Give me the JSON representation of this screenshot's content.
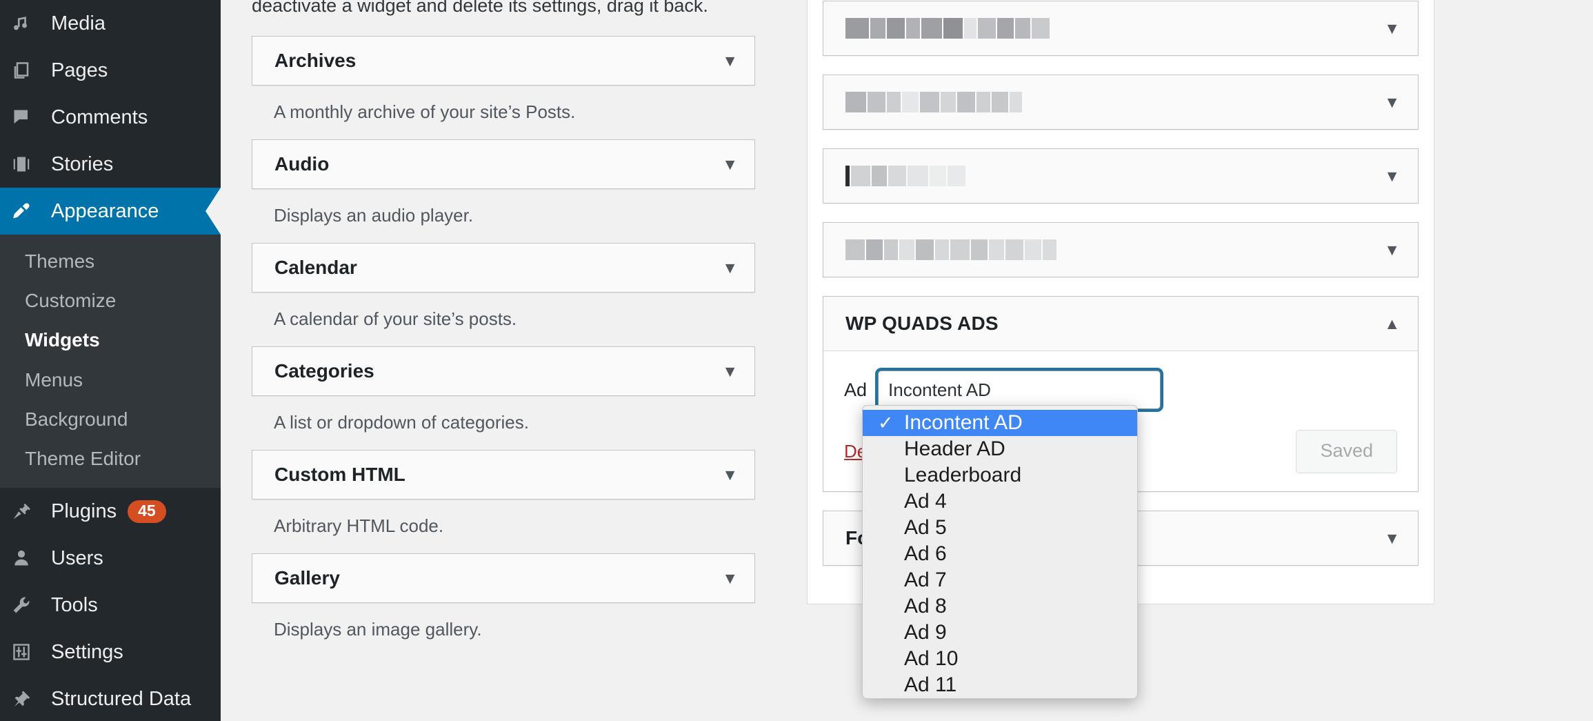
{
  "sidebar": {
    "items": [
      {
        "label": "Media",
        "icon": "media-icon",
        "current": false,
        "badge": null
      },
      {
        "label": "Pages",
        "icon": "pages-icon",
        "current": false,
        "badge": null
      },
      {
        "label": "Comments",
        "icon": "comments-icon",
        "current": false,
        "badge": null
      },
      {
        "label": "Stories",
        "icon": "stories-icon",
        "current": false,
        "badge": null
      },
      {
        "label": "Appearance",
        "icon": "appearance-icon",
        "current": true,
        "badge": null
      },
      {
        "label": "Plugins",
        "icon": "plugins-icon",
        "current": false,
        "badge": "45"
      },
      {
        "label": "Users",
        "icon": "users-icon",
        "current": false,
        "badge": null
      },
      {
        "label": "Tools",
        "icon": "tools-icon",
        "current": false,
        "badge": null
      },
      {
        "label": "Settings",
        "icon": "settings-icon",
        "current": false,
        "badge": null
      },
      {
        "label": "Structured Data",
        "icon": "structured-data-icon",
        "current": false,
        "badge": null
      }
    ],
    "submenu": [
      {
        "label": "Themes",
        "active": false
      },
      {
        "label": "Customize",
        "active": false
      },
      {
        "label": "Widgets",
        "active": true
      },
      {
        "label": "Menus",
        "active": false
      },
      {
        "label": "Background",
        "active": false
      },
      {
        "label": "Theme Editor",
        "active": false
      }
    ],
    "colors": {
      "background": "#23282d",
      "submenu_background": "#32373c",
      "current_highlight": "#0073aa",
      "badge": "#d54e21"
    }
  },
  "main": {
    "intro_text": "deactivate a widget and delete its settings, drag it back.",
    "available_widgets": [
      {
        "title": "Archives",
        "description": "A monthly archive of your site’s Posts.",
        "caret": "▼"
      },
      {
        "title": "Audio",
        "description": "Displays an audio player.",
        "caret": "▼"
      },
      {
        "title": "Calendar",
        "description": "A calendar of your site’s posts.",
        "caret": "▼"
      },
      {
        "title": "Categories",
        "description": "A list or dropdown of categories.",
        "caret": "▼"
      },
      {
        "title": "Custom HTML",
        "description": "Arbitrary HTML code.",
        "caret": "▼"
      },
      {
        "title": "Gallery",
        "description": "Displays an image gallery.",
        "caret": "▼"
      }
    ]
  },
  "widget_areas": [
    {
      "title": "",
      "redacted": true,
      "caret": "▼",
      "expanded": false
    },
    {
      "title": "",
      "redacted": true,
      "caret": "▼",
      "expanded": false
    },
    {
      "title": "",
      "redacted": true,
      "caret": "▼",
      "expanded": false
    },
    {
      "title": "",
      "redacted": true,
      "caret": "▼",
      "expanded": false
    },
    {
      "title": "WP QUADS ADS",
      "redacted": false,
      "caret": "▲",
      "expanded": true
    },
    {
      "title": "Foo",
      "redacted": false,
      "caret": "▼",
      "expanded": false
    }
  ],
  "quads_panel": {
    "field_label": "Ad",
    "selected_value": "Incontent AD",
    "delete_label": "Delete",
    "save_label": "Saved"
  },
  "ad_dropdown": {
    "check_glyph": "✓",
    "options": [
      {
        "label": "Incontent AD",
        "selected": true
      },
      {
        "label": "Header AD",
        "selected": false
      },
      {
        "label": "Leaderboard",
        "selected": false
      },
      {
        "label": "Ad 4",
        "selected": false
      },
      {
        "label": "Ad 5",
        "selected": false
      },
      {
        "label": "Ad 6",
        "selected": false
      },
      {
        "label": "Ad 7",
        "selected": false
      },
      {
        "label": "Ad 8",
        "selected": false
      },
      {
        "label": "Ad 9",
        "selected": false
      },
      {
        "label": "Ad 10",
        "selected": false
      },
      {
        "label": "Ad 11",
        "selected": false
      }
    ],
    "highlight_color": "#3f87f5",
    "focus_ring_color": "#1f74a5"
  }
}
